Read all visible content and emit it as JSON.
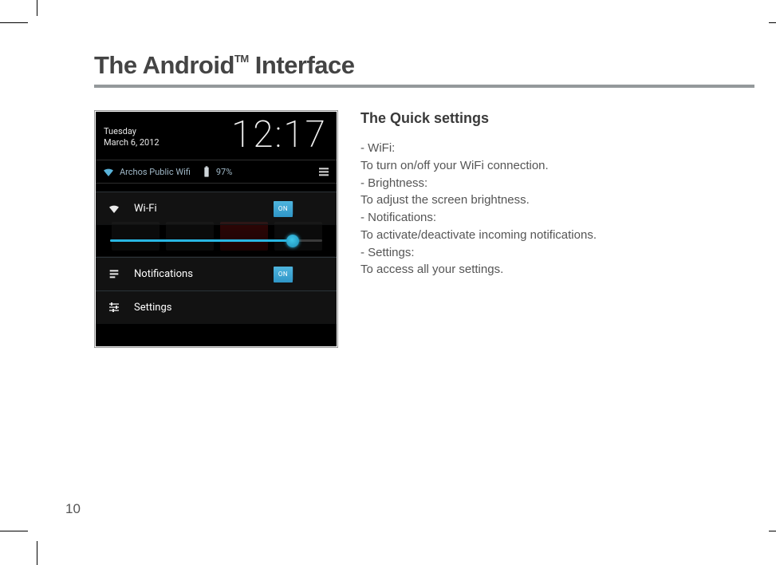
{
  "page": {
    "title_prefix": "The Android",
    "title_tm": "TM",
    "title_suffix": " Interface",
    "number": "10"
  },
  "screenshot": {
    "clock": "12:17",
    "date_day": "Tuesday",
    "date_full": "March 6, 2012",
    "status": {
      "wifi_name": "Archos Public Wifi",
      "battery": "97%"
    },
    "rows": {
      "wifi": {
        "label": "Wi-Fi",
        "toggle": "ON"
      },
      "brightness_pct": 86,
      "notifications": {
        "label": "Notifications",
        "toggle": "ON"
      },
      "settings": {
        "label": "Settings"
      }
    }
  },
  "text": {
    "heading": "The Quick settings",
    "items": [
      {
        "label": "WiFi:",
        "desc": "To turn on/off your WiFi connection."
      },
      {
        "label": "Brightness:",
        "desc": "To adjust the screen brightness."
      },
      {
        "label": "Notifications:",
        "desc": "To activate/deactivate incoming notifications."
      },
      {
        "label": "Settings:",
        "desc": "To access all your settings."
      }
    ]
  }
}
